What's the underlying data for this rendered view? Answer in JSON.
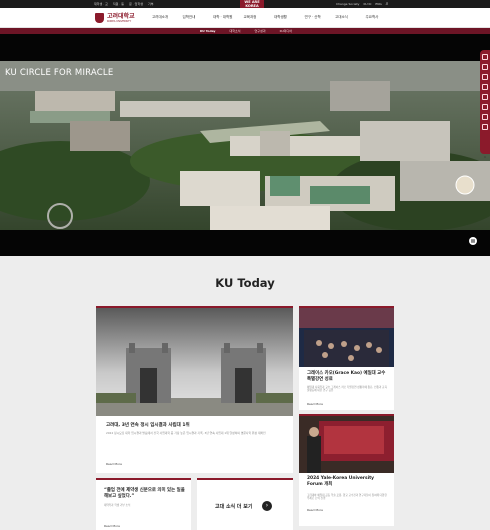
{
  "topbar": {
    "links": [
      "재학생 · 교",
      "직원 · 동",
      "문 · 입학생",
      "기부"
    ],
    "we_are": [
      "WE ARE",
      "KOREA"
    ],
    "right": [
      "Change Society",
      "KU KI",
      "ENG"
    ]
  },
  "header": {
    "logo_ko": "고려대학교",
    "logo_en": "KOREA UNIVERSITY",
    "menu": [
      "고려대소개",
      "입학안내",
      "대학 · 대학원",
      "교육과정",
      "대학생활",
      "연구 · 산학",
      "고대소식",
      "주요학사"
    ]
  },
  "subnav": {
    "items": [
      "KU Today",
      "대학소식",
      "연구성과",
      "KU미디어"
    ]
  },
  "hero": {
    "title": "KU CIRCLE FOR MIRACLE"
  },
  "section_title": "KU Today",
  "main_card": {
    "title": "고려대, 3년 연속 정시 입시결과 사립대 1위",
    "desc": "2024 정시모집 대학 입시결과 발표에서 전국 사립대학 중 가장 높은 입시결과 기록, 3년 연속 사립대 1위 달성하며 명문사학 위상 재확인",
    "more": "Read More"
  },
  "side1": {
    "title": "그레이스 카오(Grace Kao) 예일대 교수 특별강연 성료",
    "desc": "예일대 사회학과 교수 그레이스 카오 특별강연 성황리에 종료, 인종과 교육 불평등에 대한 연구 공유",
    "more": "Read More"
  },
  "side2": {
    "title": "2024 Yale-Korea University Forum 개최",
    "desc": "고려대와 예일대 공동 학술 포럼, 양교 교수진과 연구자들이 참여해 다양한 주제로 논의 진행",
    "more": "Read More"
  },
  "quote_card": {
    "quote": "“졸업 전에 제약생 신분으로 의미 있는 일을 해보고 싶었다.”",
    "desc": "제약학과 학생 기부 소식",
    "more": "Read More"
  },
  "news_button": {
    "label": "고대 소식 더 보기",
    "arrow": "›"
  },
  "icons": [
    "search-icon",
    "pause-icon",
    "chevron-up-icon",
    "arrow-right-icon"
  ]
}
